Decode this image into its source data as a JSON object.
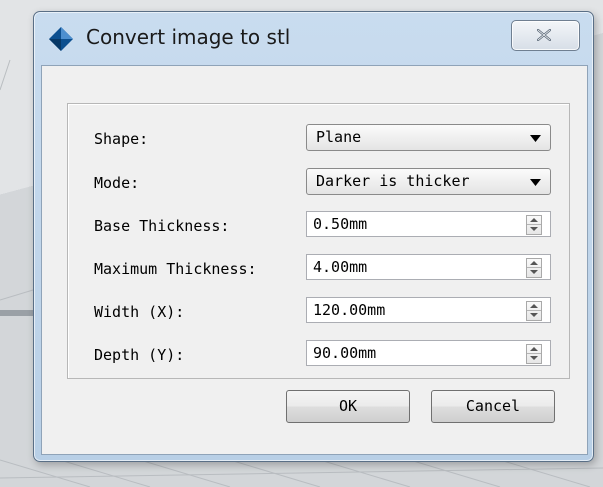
{
  "dialog": {
    "title": "Convert image to stl",
    "close_icon": "close-icon",
    "app_icon": "diamond-app-icon"
  },
  "form": {
    "shape": {
      "label": "Shape:",
      "value": "Plane"
    },
    "mode": {
      "label": "Mode:",
      "value": "Darker is thicker"
    },
    "base_thickness": {
      "label": "Base Thickness:",
      "value": "0.50mm"
    },
    "maximum_thickness": {
      "label": "Maximum Thickness:",
      "value": "4.00mm"
    },
    "width": {
      "label": "Width (X):",
      "value": "120.00mm"
    },
    "depth": {
      "label": "Depth (Y):",
      "value": "90.00mm"
    }
  },
  "buttons": {
    "ok": "OK",
    "cancel": "Cancel"
  },
  "colors": {
    "title_bar": "#c9dcef",
    "client_bg": "#f0f0f0",
    "app_icon": "#0c4f8f"
  }
}
